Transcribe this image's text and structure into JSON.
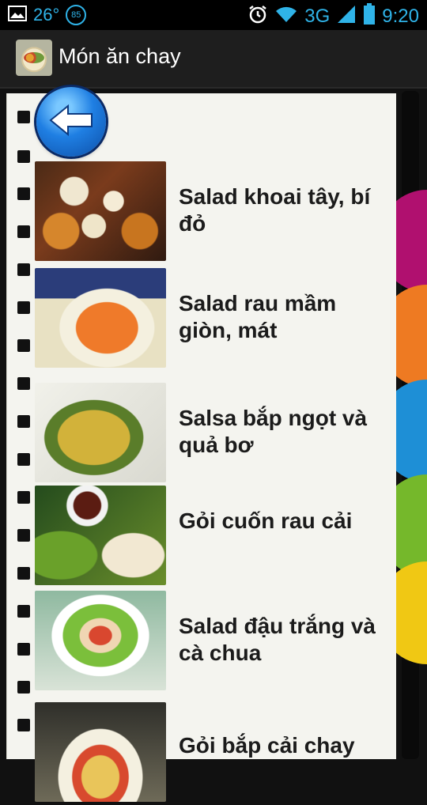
{
  "status": {
    "temperature": "26°",
    "badge": "85",
    "network": "3G",
    "time": "9:20",
    "icons": [
      "image-icon",
      "alarm-icon",
      "wifi-icon",
      "signal-icon",
      "battery-icon"
    ]
  },
  "app": {
    "title": "Món ăn chay"
  },
  "recipes": [
    {
      "title": "Salad khoai tây, bí đỏ"
    },
    {
      "title": "Salad rau mầm giòn, mát"
    },
    {
      "title": "Salsa bắp ngọt và quả bơ"
    },
    {
      "title": "Gỏi cuốn rau cải"
    },
    {
      "title": "Salad đậu trắng và cà chua"
    },
    {
      "title": "Gỏi bắp cải chay"
    }
  ],
  "colors": {
    "accent": "#2fb3e8",
    "tabs": [
      "#b0106f",
      "#ee7a22",
      "#1e8fd6",
      "#75b82b",
      "#f0c814"
    ]
  }
}
